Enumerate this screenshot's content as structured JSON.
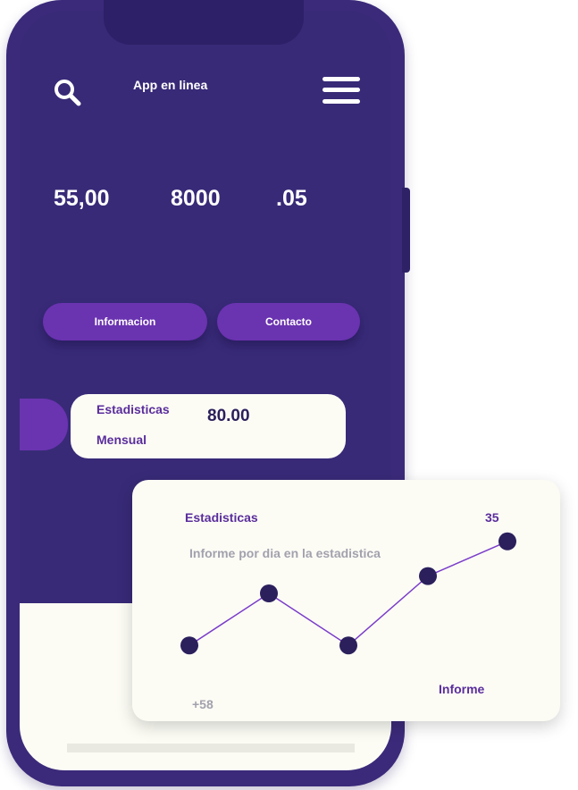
{
  "header": {
    "title": "App en linea",
    "search_icon": "search-icon",
    "menu_icon": "hamburger-menu-icon"
  },
  "stats": [
    {
      "value": "55,00"
    },
    {
      "value": "8000"
    },
    {
      "value": ".05"
    }
  ],
  "buttons": {
    "info_label": "Informacion",
    "contact_label": "Contacto"
  },
  "stats_card": {
    "line1": "Estadisticas",
    "line2": "Mensual",
    "value": "80.00"
  },
  "chart_card": {
    "title": "Estadisticas",
    "value": "35",
    "subtitle": "Informe por dia en la estadistica",
    "footer_label": "Informe",
    "start_label": "+58"
  },
  "colors": {
    "primary": "#382a77",
    "accent": "#6a33b0",
    "card_bg": "#fcfcf5",
    "line": "#7a3cc9",
    "point": "#2b1f5c"
  },
  "chart_data": {
    "type": "line",
    "x": [
      1,
      2,
      3,
      4,
      5
    ],
    "values": [
      58,
      70,
      58,
      74,
      82
    ],
    "ylim": [
      50,
      90
    ],
    "grid": false,
    "title": "Estadisticas"
  }
}
